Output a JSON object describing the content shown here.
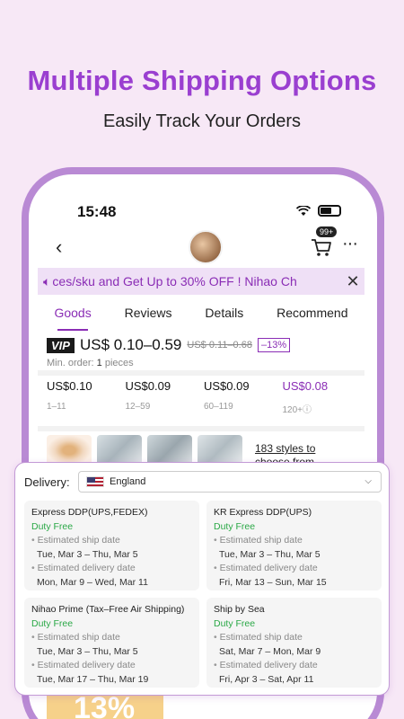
{
  "headline": "Multiple Shipping Options",
  "subline": "Easily Track Your Orders",
  "status_bar": {
    "time": "15:48"
  },
  "nav": {
    "cart_badge": "99+",
    "more": "···"
  },
  "promo": {
    "text": "ces/sku and Get Up to 30% OFF !      Nihao Ch"
  },
  "tabs": [
    "Goods",
    "Reviews",
    "Details",
    "Recommend"
  ],
  "price": {
    "vip": "VIP",
    "range": "US$ 0.10–0.59",
    "old": "US$ 0.11–0.68",
    "discount": "–13%",
    "min_order_label": "Min. order:",
    "min_order_value": "1",
    "min_order_unit": "pieces"
  },
  "tiers": [
    {
      "price": "US$0.10",
      "qty": "1–11"
    },
    {
      "price": "US$0.09",
      "qty": "12–59"
    },
    {
      "price": "US$0.09",
      "qty": "60–119"
    },
    {
      "price": "US$0.08",
      "qty": "120+ⓘ"
    }
  ],
  "styles_link": "183 styles to\nchoose from",
  "banner_text": "13%",
  "delivery": {
    "label": "Delivery:",
    "country": "England",
    "options": [
      {
        "name": "Express DDP(UPS,FEDEX)",
        "duty": "Duty Free",
        "ship_label": "Estimated ship date",
        "ship_value": "Tue, Mar 3 – Thu, Mar 5",
        "delivery_label": "Estimated delivery date",
        "delivery_value": "Mon, Mar 9 – Wed, Mar 11"
      },
      {
        "name": "KR Express DDP(UPS)",
        "duty": "Duty Free",
        "ship_label": "Estimated ship date",
        "ship_value": "Tue, Mar 3 – Thu, Mar 5",
        "delivery_label": "Estimated delivery date",
        "delivery_value": "Fri, Mar 13 – Sun, Mar 15"
      },
      {
        "name": "Nihao Prime (Tax–Free Air Shipping)",
        "duty": "Duty Free",
        "ship_label": "Estimated ship date",
        "ship_value": "Tue, Mar 3 – Thu, Mar 5",
        "delivery_label": "Estimated delivery date",
        "delivery_value": "Tue, Mar 17 – Thu, Mar 19"
      },
      {
        "name": "Ship by Sea",
        "duty": "Duty Free",
        "ship_label": "Estimated ship date",
        "ship_value": "Sat, Mar 7 – Mon, Mar 9",
        "delivery_label": "Estimated delivery date",
        "delivery_value": "Fri, Apr 3 – Sat, Apr 11"
      }
    ]
  },
  "colors": {
    "accent": "#8a2db5",
    "headline": "#9a3fd0",
    "duty_free": "#2aa846",
    "background": "#f7e8f6"
  }
}
